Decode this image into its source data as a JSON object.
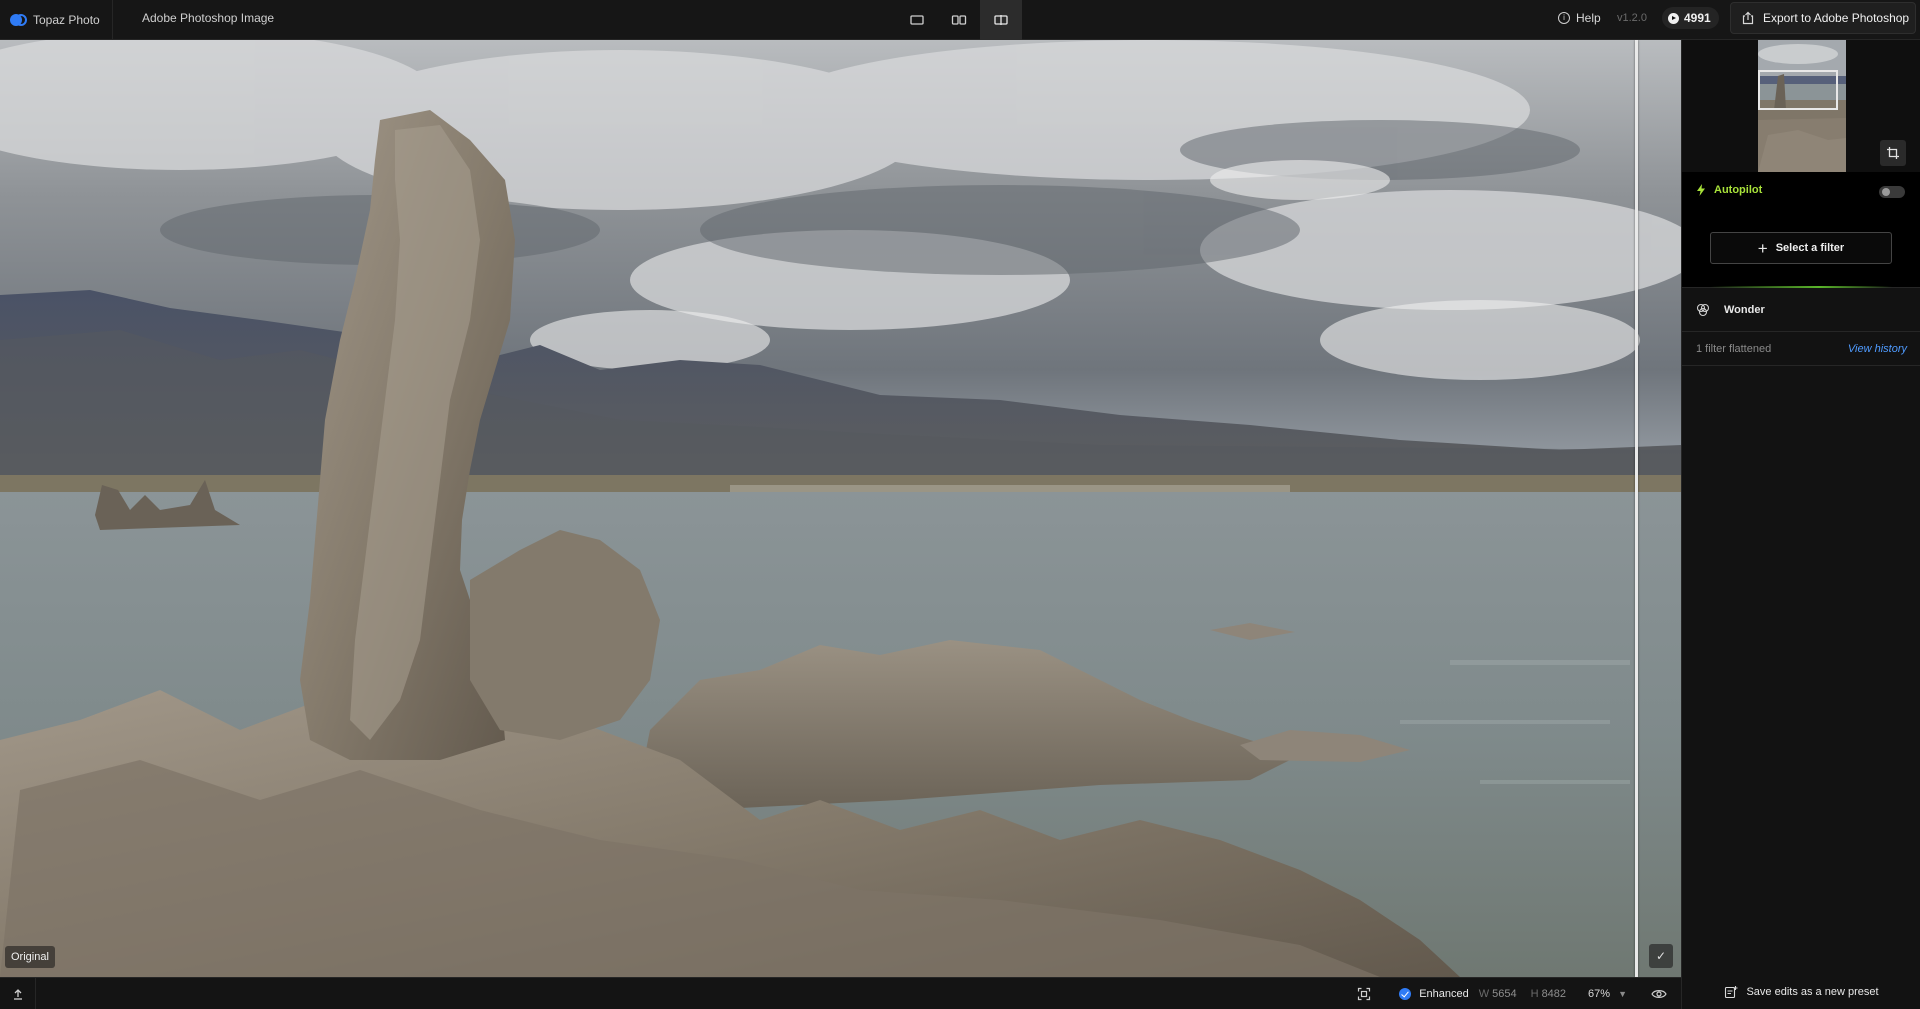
{
  "topbar": {
    "brand": "Topaz Photo",
    "document_title": "Adobe Photoshop Image",
    "help_label": "Help",
    "version": "v1.2.0",
    "credits": "4991",
    "export_label": "Export to Adobe Photoshop",
    "view_modes": [
      "single-view",
      "side-by-side",
      "split-view"
    ],
    "active_view": "split-view"
  },
  "canvas": {
    "original_label": "Original",
    "check_icon": "checkmark-icon"
  },
  "bottombar": {
    "status_label": "Enhanced",
    "width_key": "W",
    "width_value": "5654",
    "height_key": "H",
    "height_value": "8482",
    "zoom": "67%"
  },
  "sidepanel": {
    "autopilot_label": "Autopilot",
    "autopilot_enabled": false,
    "select_filter_label": "Select a filter",
    "filter_name": "Wonder",
    "flattened_text": "1 filter flattened",
    "view_history_label": "View history",
    "save_preset_label": "Save edits as a new preset"
  },
  "colors": {
    "accent_blue": "#2f7bf5",
    "autopilot_green": "#a8e23a",
    "link_blue": "#4f9bff"
  }
}
